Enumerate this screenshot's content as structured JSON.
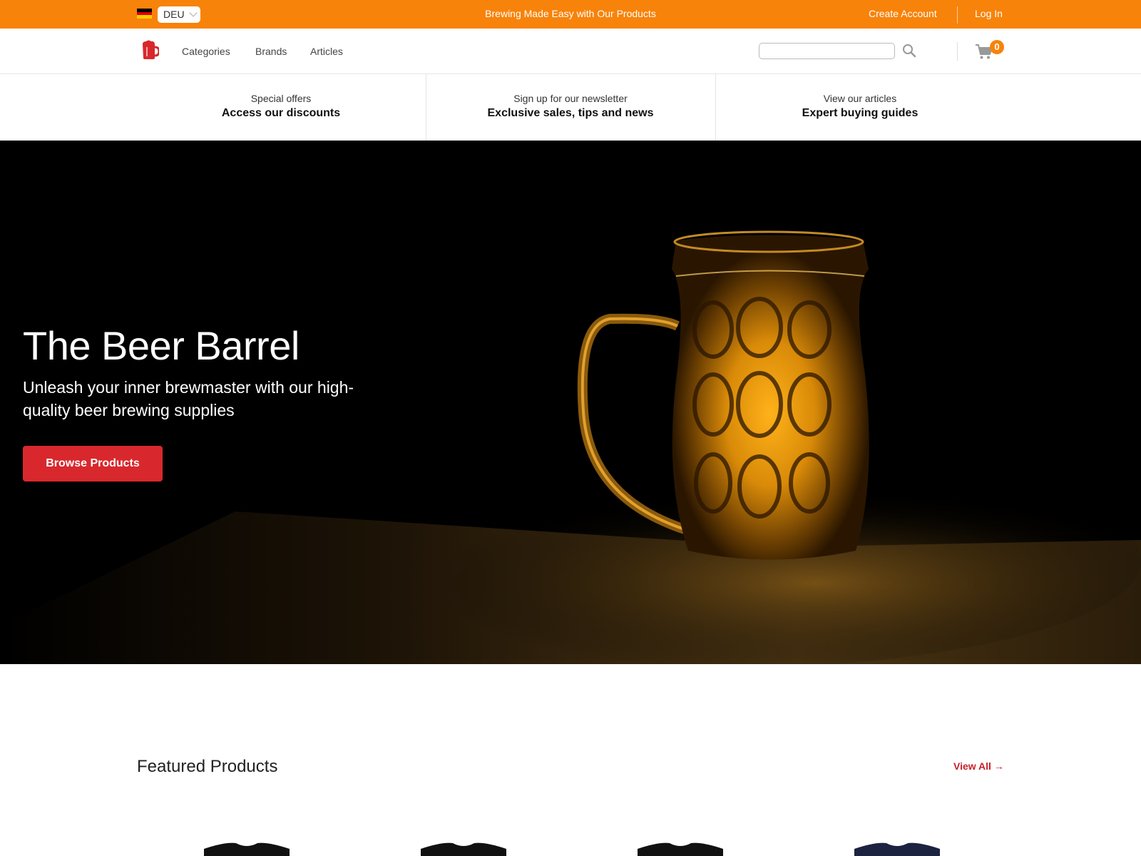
{
  "topbar": {
    "flag_colors": [
      "#000000",
      "#dd0000",
      "#ffce00"
    ],
    "language": "DEU",
    "promo": "Brewing Made Easy with Our Products",
    "create_account": "Create Account",
    "login": "Log In"
  },
  "nav": {
    "logo_icon": "beer-mug-icon",
    "links": [
      "Categories",
      "Brands",
      "Articles"
    ],
    "search_placeholder": "",
    "search_icon": "search-icon",
    "cart_icon": "cart-icon",
    "cart_count": "0"
  },
  "strip": [
    {
      "small": "Special offers",
      "big": "Access our discounts"
    },
    {
      "small": "Sign up for our newsletter",
      "big": "Exclusive sales, tips and news"
    },
    {
      "small": "View our articles",
      "big": "Expert buying guides"
    }
  ],
  "hero": {
    "title": "The Beer Barrel",
    "subtitle": "Unleash your inner brewmaster with our high-quality beer brewing supplies",
    "button": "Browse Products"
  },
  "featured": {
    "title": "Featured Products",
    "view_all": "View All →"
  },
  "colors": {
    "accent": "#f7830a",
    "brand_red": "#d8282d",
    "link_red": "#c8202a"
  }
}
